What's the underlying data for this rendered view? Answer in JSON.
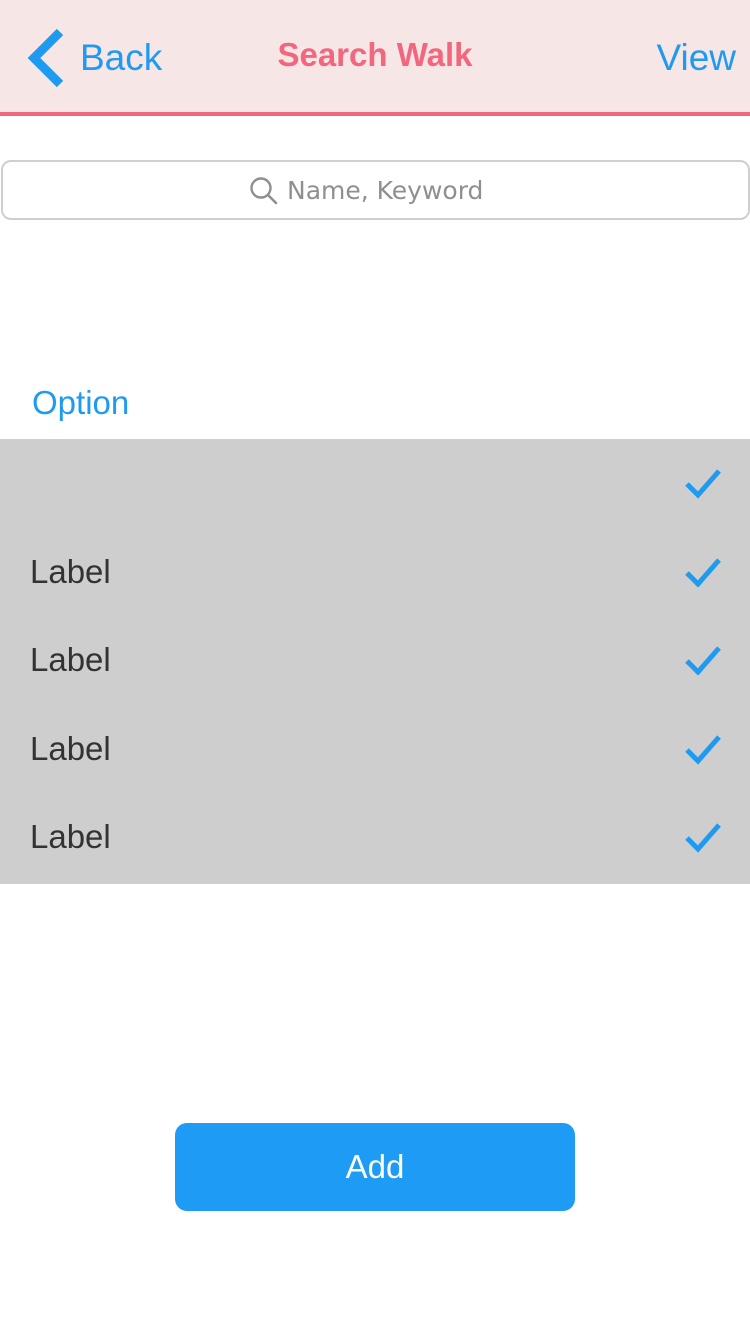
{
  "header": {
    "back_label": "Back",
    "title": "Search Walk",
    "view_label": "View"
  },
  "search": {
    "placeholder": "Name, Keyword",
    "value": ""
  },
  "section": {
    "title": "Option"
  },
  "options": [
    {
      "label": "",
      "checked": true
    },
    {
      "label": "Label",
      "checked": true
    },
    {
      "label": "Label",
      "checked": true
    },
    {
      "label": "Label",
      "checked": true
    },
    {
      "label": "Label",
      "checked": true
    }
  ],
  "actions": {
    "add_label": "Add"
  },
  "colors": {
    "accent": "#1e9bf0",
    "title": "#f2677e",
    "header_bg": "#f7e6e6",
    "list_bg": "#cecece"
  },
  "icons": {
    "back": "chevron-left-icon",
    "search": "search-icon",
    "check": "checkmark-icon"
  }
}
